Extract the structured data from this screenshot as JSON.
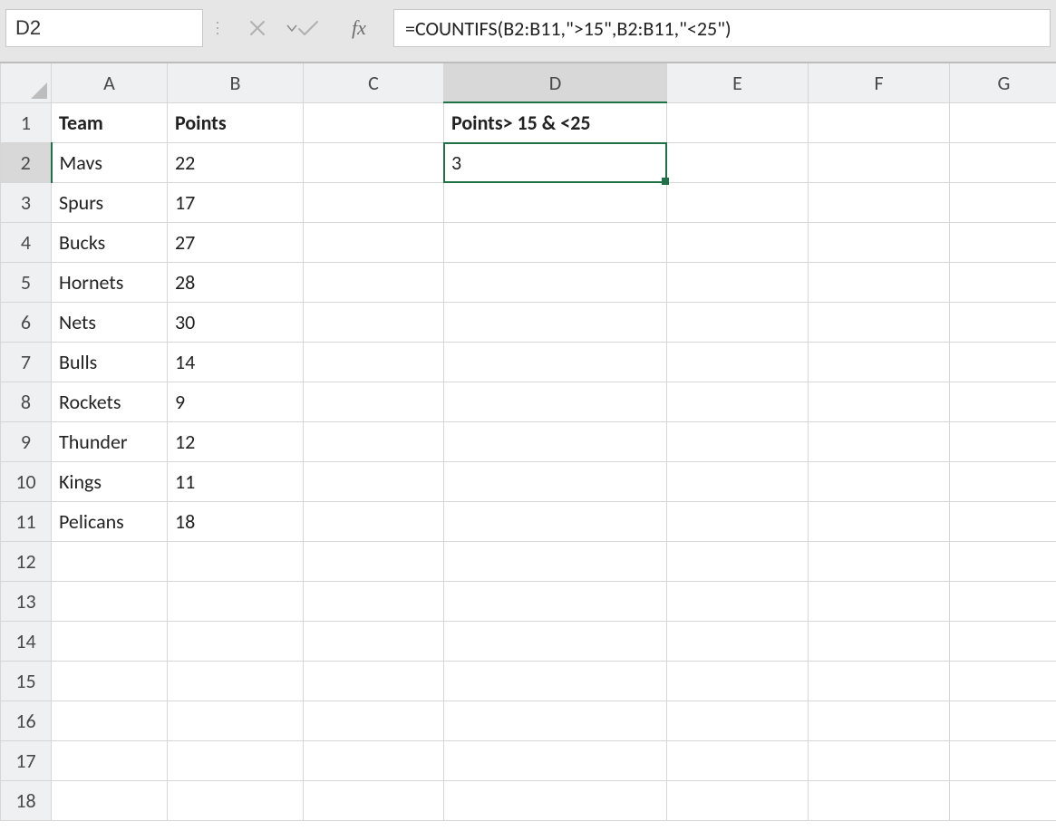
{
  "nameBox": {
    "value": "D2"
  },
  "formulaBar": {
    "fxLabel": "fx",
    "formula": "=COUNTIFS(B2:B11,\">15\",B2:B11,\"<25\")"
  },
  "columns": [
    "A",
    "B",
    "C",
    "D",
    "E",
    "F",
    "G"
  ],
  "activeColumnIndex": 3,
  "activeRowIndex": 1,
  "rowCount": 18,
  "headers": {
    "A1": "Team",
    "B1": "Points",
    "D1": "Points> 15 & <25"
  },
  "data": {
    "teams": [
      "Mavs",
      "Spurs",
      "Bucks",
      "Hornets",
      "Nets",
      "Bulls",
      "Rockets",
      "Thunder",
      "Kings",
      "Pelicans"
    ],
    "points": [
      22,
      17,
      27,
      28,
      30,
      14,
      9,
      12,
      11,
      18
    ]
  },
  "result": {
    "D2": 3
  },
  "chart_data": {
    "type": "table",
    "title": "",
    "columns": [
      "Team",
      "Points"
    ],
    "rows": [
      [
        "Mavs",
        22
      ],
      [
        "Spurs",
        17
      ],
      [
        "Bucks",
        27
      ],
      [
        "Hornets",
        28
      ],
      [
        "Nets",
        30
      ],
      [
        "Bulls",
        14
      ],
      [
        "Rockets",
        9
      ],
      [
        "Thunder",
        12
      ],
      [
        "Kings",
        11
      ],
      [
        "Pelicans",
        18
      ]
    ],
    "derived": {
      "label": "Points> 15 & <25",
      "value": 3
    }
  }
}
